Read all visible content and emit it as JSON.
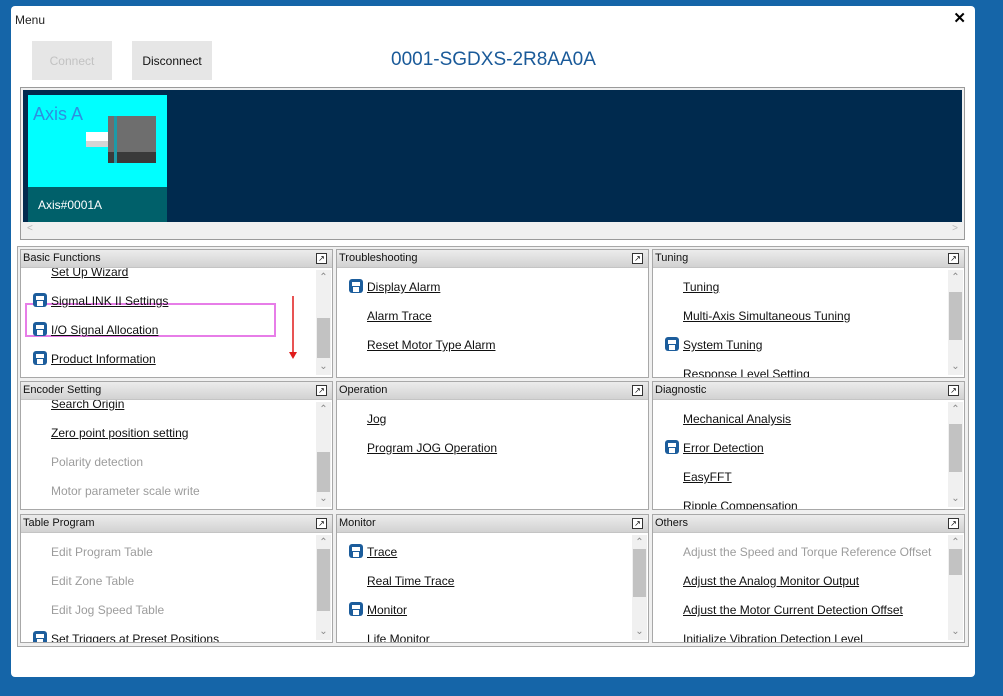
{
  "window": {
    "title": "Menu",
    "close": "✕"
  },
  "toolbar": {
    "connect_label": "Connect",
    "disconnect_label": "Disconnect"
  },
  "device": {
    "name": "0001-SGDXS-2R8AA0A"
  },
  "axis": {
    "name": "Axis A",
    "id": "Axis#0001A"
  },
  "panels": {
    "basic": {
      "title": "Basic Functions",
      "items": [
        {
          "label": "Set Up Wizard"
        },
        {
          "label": "SigmaLINK II Settings"
        },
        {
          "label": "I/O Signal Allocation"
        },
        {
          "label": "Product Information"
        }
      ]
    },
    "trouble": {
      "title": "Troubleshooting",
      "items": [
        {
          "label": "Display Alarm"
        },
        {
          "label": "Alarm Trace"
        },
        {
          "label": "Reset Motor Type Alarm"
        }
      ]
    },
    "tuning": {
      "title": "Tuning",
      "items": [
        {
          "label": "Tuning"
        },
        {
          "label": "Multi-Axis Simultaneous Tuning"
        },
        {
          "label": "System Tuning"
        },
        {
          "label": "Response Level Setting"
        }
      ]
    },
    "encoder": {
      "title": "Encoder Setting",
      "items": [
        {
          "label": "Search Origin"
        },
        {
          "label": "Zero point position setting"
        },
        {
          "label": "Polarity detection"
        },
        {
          "label": "Motor parameter scale write"
        }
      ]
    },
    "operation": {
      "title": "Operation",
      "items": [
        {
          "label": "Jog"
        },
        {
          "label": "Program JOG Operation"
        }
      ]
    },
    "diagnostic": {
      "title": "Diagnostic",
      "items": [
        {
          "label": "Mechanical Analysis"
        },
        {
          "label": "Error Detection"
        },
        {
          "label": "EasyFFT"
        },
        {
          "label": "Ripple Compensation"
        }
      ]
    },
    "table": {
      "title": "Table Program",
      "items": [
        {
          "label": "Edit Program Table"
        },
        {
          "label": "Edit Zone Table"
        },
        {
          "label": "Edit Jog Speed Table"
        },
        {
          "label": "Set Triggers at Preset Positions"
        }
      ]
    },
    "monitor": {
      "title": "Monitor",
      "items": [
        {
          "label": "Trace"
        },
        {
          "label": "Real Time Trace"
        },
        {
          "label": "Monitor"
        },
        {
          "label": "Life Monitor"
        }
      ]
    },
    "others": {
      "title": "Others",
      "items": [
        {
          "label": "Adjust the Speed and Torque Reference Offset"
        },
        {
          "label": "Adjust the Analog Monitor Output"
        },
        {
          "label": "Adjust the Motor Current Detection Offset"
        },
        {
          "label": "Initialize Vibration Detection Level"
        }
      ]
    }
  },
  "colors": {
    "background": "#1565a8",
    "axis_card": "#00ffff",
    "axis_footer": "#00606a",
    "axis_area": "#002a4e",
    "device_text": "#1a5a99",
    "highlight": "#e77de8",
    "arrow": "#e01b1b"
  },
  "icons": {
    "secure_item": "padlock-icon",
    "expand": "expand-icon"
  }
}
